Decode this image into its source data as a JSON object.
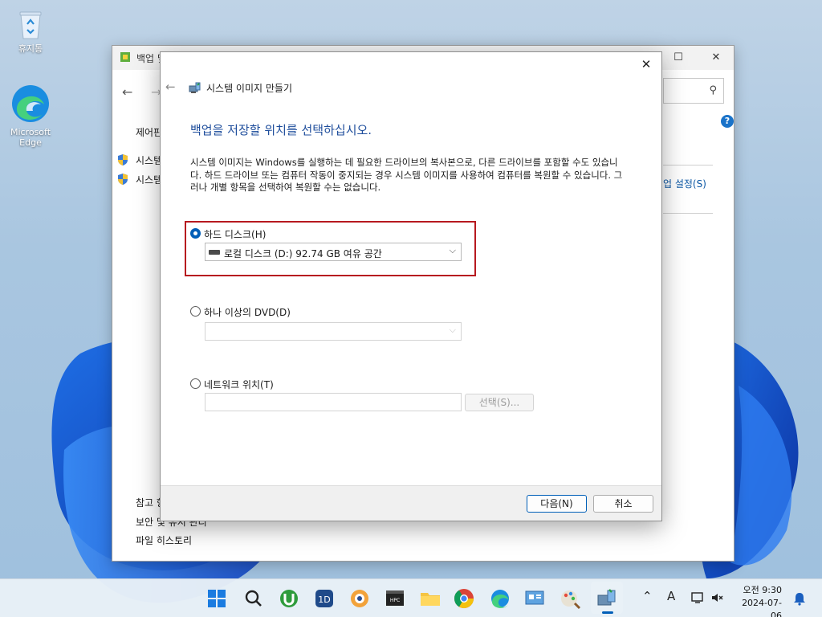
{
  "desktop": {
    "recycle_bin": "휴지통",
    "edge_line1": "Microsoft",
    "edge_line2": "Edge"
  },
  "back_window": {
    "title": "백업 및",
    "breadcrumb_fragment": "제어판",
    "item_1": "시스템",
    "item_2": "시스템",
    "right_link": "업 설정(S)",
    "see_also": "참고 항",
    "link_security": "보안 및 유지 관리",
    "link_file_history": "파일 히스토리",
    "help": "?"
  },
  "dialog": {
    "title": "시스템 이미지 만들기",
    "heading": "백업을 저장할 위치를 선택하십시오.",
    "description": "시스템 이미지는 Windows를 실행하는 데 필요한 드라이브의 복사본으로, 다른 드라이브를 포함할 수도 있습니다. 하드 드라이브 또는 컴퓨터 작동이 중지되는 경우 시스템 이미지를 사용하여 컴퓨터를 복원할 수 있습니다. 그러나 개별 항목을 선택하여 복원할 수는 없습니다.",
    "option_hard_disk": "하드 디스크(H)",
    "hard_disk_selected": "로컬 디스크 (D:)  92.74 GB 여유 공간",
    "option_dvd": "하나 이상의 DVD(D)",
    "option_network": "네트워크 위치(T)",
    "network_path": "",
    "select_button": "선택(S)...",
    "next_button": "다음(N)",
    "cancel_button": "취소"
  },
  "taskbar": {
    "clock_top": "오전 9:30",
    "clock_bottom": "2024-07-06",
    "ime": "A"
  },
  "colors": {
    "accent": "#005fb8",
    "heading": "#1f4e9c",
    "highlight_border": "#b7191f"
  }
}
